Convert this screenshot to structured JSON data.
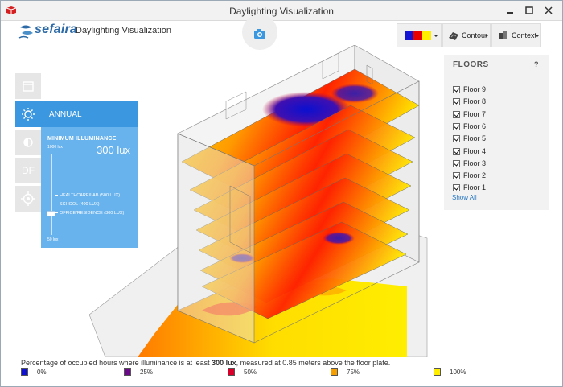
{
  "window": {
    "title": "Daylighting Visualization"
  },
  "app": {
    "brand": "sefaira",
    "subtitle": "Daylighting Visualization"
  },
  "toolbar": {
    "palette_colors": [
      "#1414d4",
      "#e80000",
      "#ffee00"
    ],
    "contour_label": "Contour",
    "context_label": "Context"
  },
  "floors": {
    "title": "FLOORS",
    "help": "?",
    "items": [
      "Floor 9",
      "Floor 8",
      "Floor 7",
      "Floor 6",
      "Floor 5",
      "Floor 4",
      "Floor 3",
      "Floor 2",
      "Floor 1"
    ],
    "show_all": "Show All"
  },
  "side_tabs": {
    "df_label": "DF"
  },
  "annual": {
    "label": "ANNUAL",
    "min_illuminance_label": "MINIMUM ILLUMINANCE",
    "value": "300 lux",
    "scale_max": "1000 lux",
    "scale_min": "50 lux",
    "presets": [
      "HEALTHCARE/LAB (500 LUX)",
      "SCHOOL (400 LUX)",
      "OFFICE/RESIDENCE (300 LUX)"
    ]
  },
  "footer": {
    "text_before": "Percentage of occupied hours where illuminance is at least ",
    "threshold": "300 lux",
    "text_after": ", measured at 0.85 meters above the floor plate."
  },
  "legend": [
    {
      "label": "0%",
      "color": "#1010d0"
    },
    {
      "label": "25%",
      "color": "#6a0a8a"
    },
    {
      "label": "50%",
      "color": "#d8002a"
    },
    {
      "label": "75%",
      "color": "#f5a000"
    },
    {
      "label": "100%",
      "color": "#ffee00"
    }
  ]
}
